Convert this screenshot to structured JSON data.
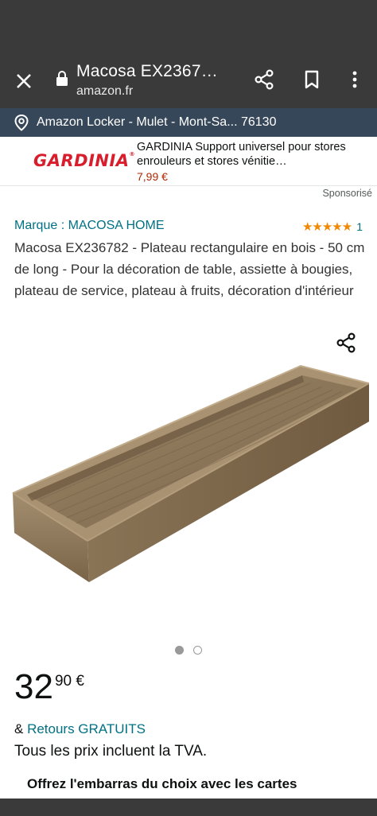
{
  "browser": {
    "title": "Macosa EX2367…",
    "url": "amazon.fr",
    "icons": [
      "close-icon",
      "lock-icon",
      "share-icon",
      "bookmark-icon",
      "more-vert-icon"
    ]
  },
  "location": {
    "text": "Amazon Locker - Mulet - Mont-Sa... 76130",
    "icon": "location-pin-icon"
  },
  "ad": {
    "brand": "GARDINIA",
    "title": "GARDINIA Support universel pour stores enrouleurs et stores vénitie…",
    "price": "7,99 €",
    "sponsored_label": "Sponsorisé"
  },
  "product": {
    "brand_label": "Marque : MACOSA HOME",
    "rating_stars": 5,
    "stars_text": "★★★★★",
    "rating_count": "1",
    "title": "Macosa EX236782 - Plateau rectangulaire en bois - 50 cm de long - Pour la décoration de table, assiette à bougies, plateau de service, plateau à fruits, décoration d'intérieur",
    "image_count": 2,
    "active_image": 1
  },
  "price": {
    "whole": "32",
    "fraction": "90 €"
  },
  "returns": {
    "prefix": "& ",
    "link": "Retours GRATUITS"
  },
  "tax_note": "Tous les prix incluent la TVA.",
  "promo_text": "Offrez l'embarras du choix avec les cartes",
  "colors": {
    "browser_bar": "#3a3a3a",
    "location_bar": "#37475a",
    "link": "#007185",
    "star": "#f08804",
    "ad_brand": "#d81e2c",
    "ad_price": "#b12704"
  }
}
